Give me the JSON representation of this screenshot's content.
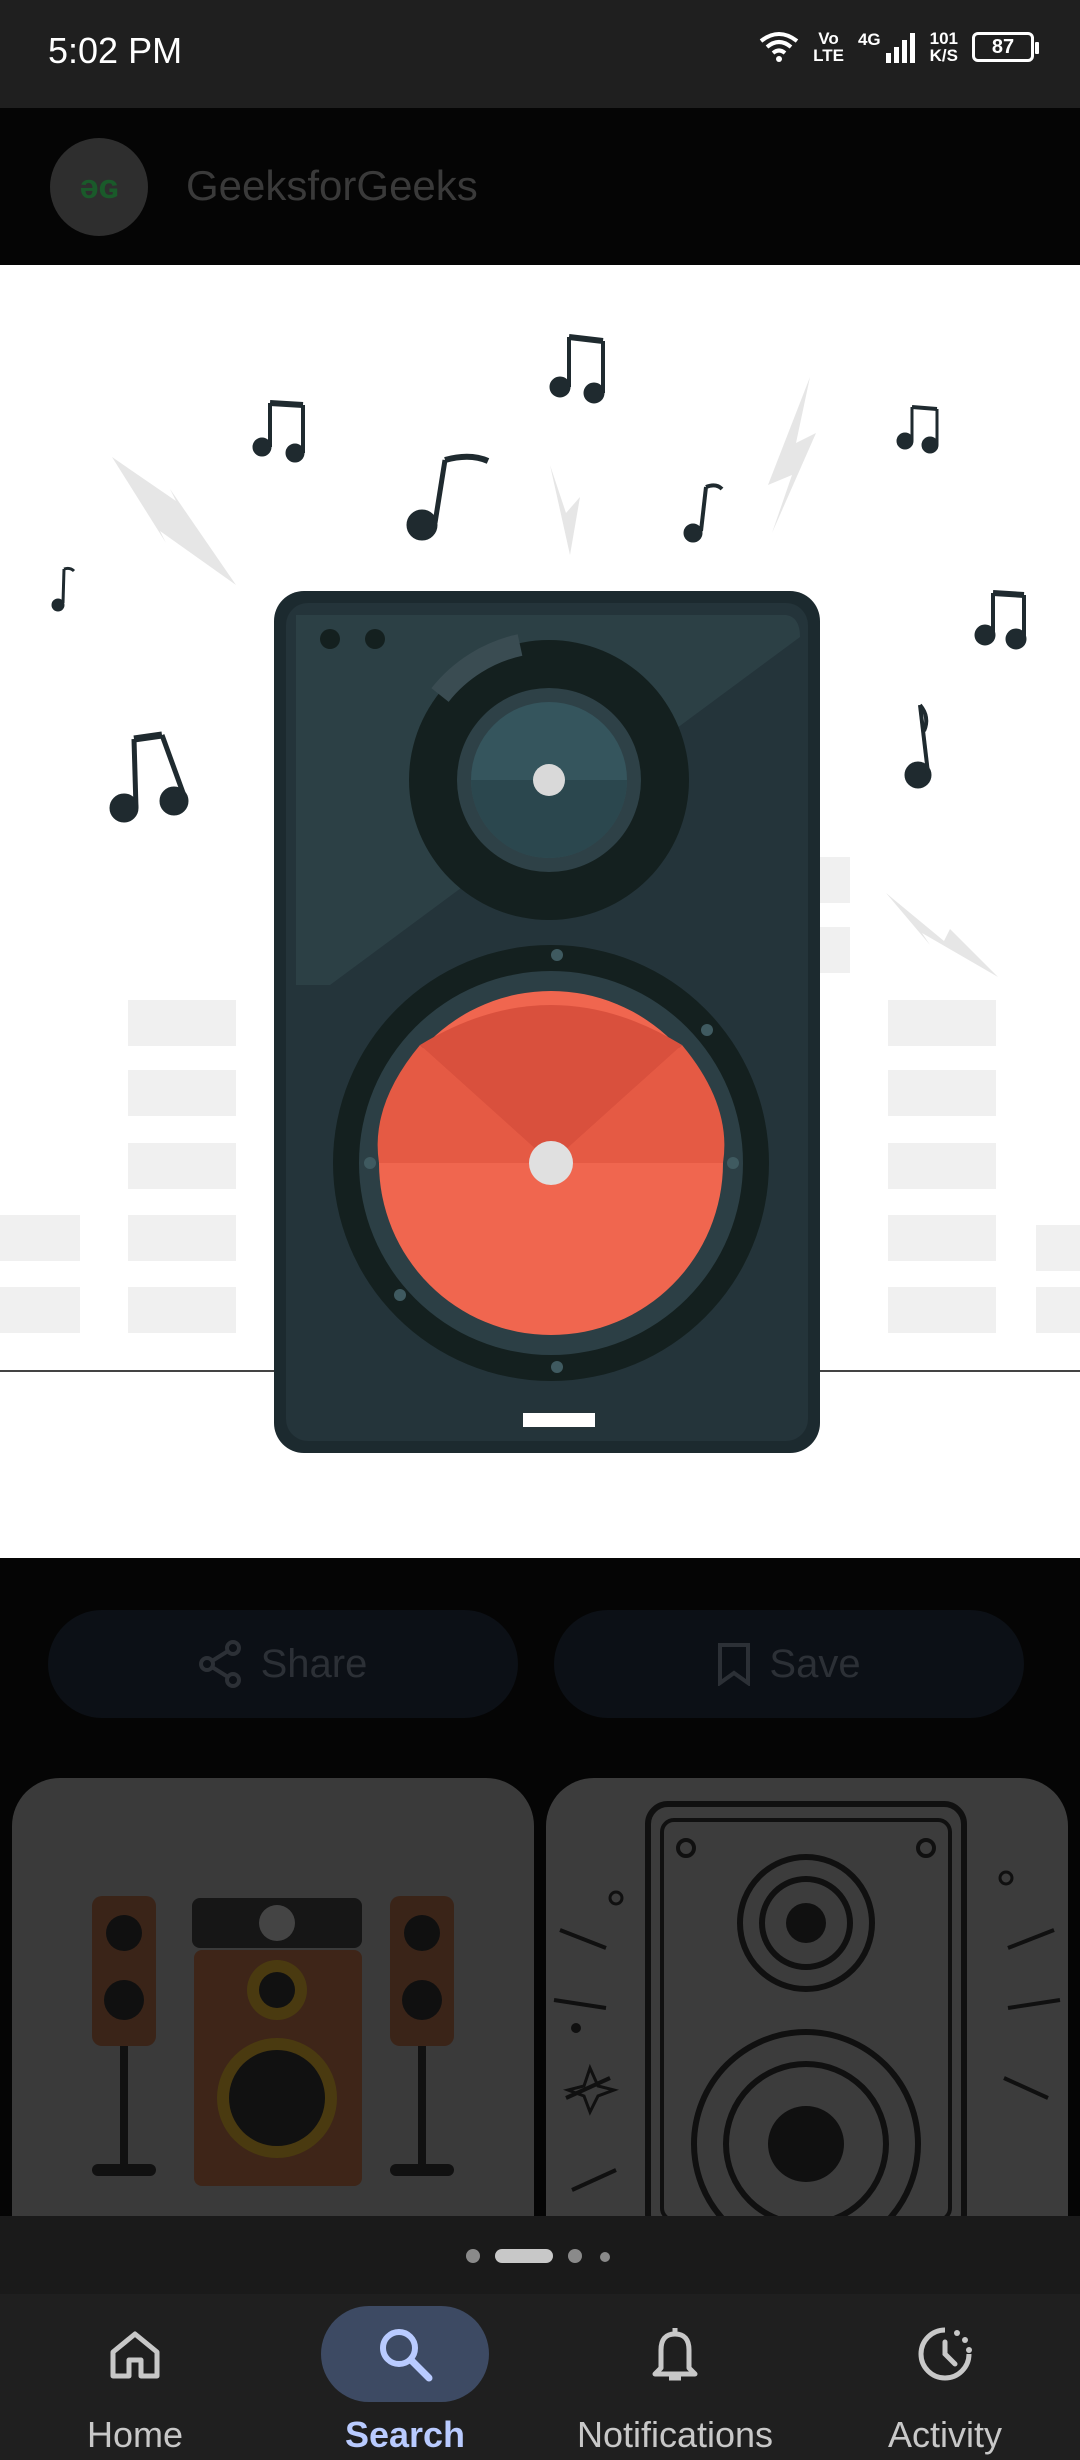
{
  "status_bar": {
    "time": "5:02 PM",
    "volte_top": "Vo",
    "volte_bottom": "LTE",
    "network": "4G",
    "speed_top": "101",
    "speed_bottom": "K/S",
    "battery": "87",
    "icons": [
      "wifi-icon",
      "signal-icon",
      "battery-icon"
    ]
  },
  "source": {
    "logo_text": "ǝɢ",
    "name": "GeeksforGeeks"
  },
  "hero_image": {
    "subject": "speaker-illustration",
    "colors": {
      "cabinet": "#24343a",
      "woofer": "#f46b52",
      "background": "#ffffff"
    }
  },
  "actions": {
    "share_label": "Share",
    "save_label": "Save"
  },
  "related": [
    {
      "subject": "home-theater-speakers-image"
    },
    {
      "subject": "speaker-line-drawing-image"
    }
  ],
  "pager": {
    "total": 4,
    "active_index": 1
  },
  "bottom_nav": {
    "items": [
      {
        "label": "Home",
        "icon": "home-icon",
        "active": false
      },
      {
        "label": "Search",
        "icon": "search-icon",
        "active": true
      },
      {
        "label": "Notifications",
        "icon": "bell-icon",
        "active": false
      },
      {
        "label": "Activity",
        "icon": "activity-icon",
        "active": false
      }
    ],
    "accent": "#b9cbff"
  }
}
